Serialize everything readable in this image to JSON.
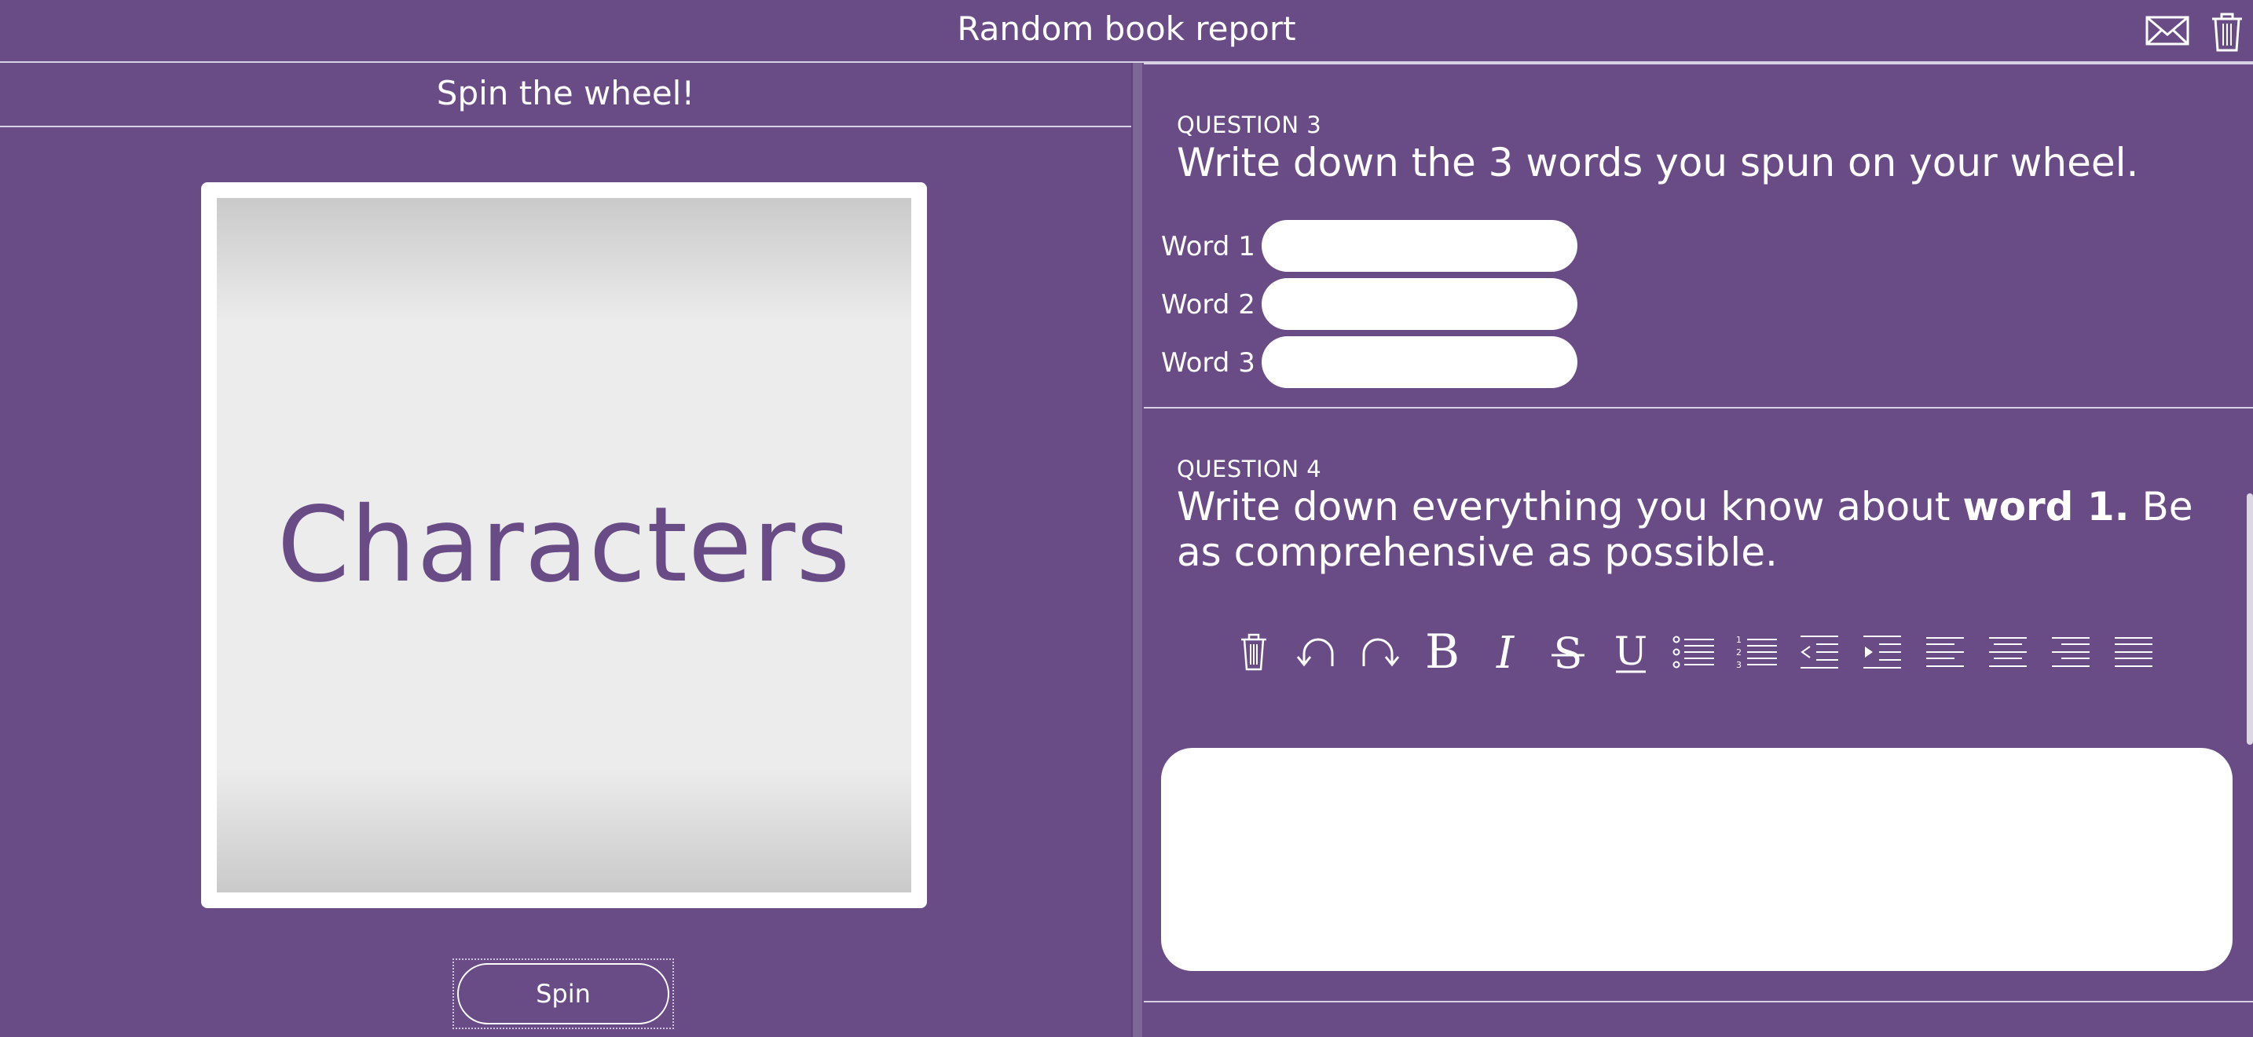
{
  "header": {
    "title": "Random book report",
    "mail_icon": "envelope-icon",
    "trash_icon": "trash-icon"
  },
  "left": {
    "title": "Spin the wheel!",
    "wheel_word": "Characters",
    "spin_label": "Spin"
  },
  "question3": {
    "label": "QUESTION 3",
    "prompt": "Write down the 3 words you spun on your wheel.",
    "fields": [
      {
        "label": "Word 1",
        "value": ""
      },
      {
        "label": "Word 2",
        "value": ""
      },
      {
        "label": "Word 3",
        "value": ""
      }
    ]
  },
  "question4": {
    "label": "QUESTION 4",
    "prompt_before": "Write down everything you know about ",
    "prompt_bold": "word 1.",
    "prompt_after": " Be as comprehensive as possible.",
    "toolbar": [
      "trash-icon",
      "undo-icon",
      "redo-icon",
      "bold-icon",
      "italic-icon",
      "strikethrough-icon",
      "underline-icon",
      "bullet-list-icon",
      "numbered-list-icon",
      "outdent-icon",
      "indent-icon",
      "align-left-icon",
      "align-center-icon",
      "align-right-icon",
      "justify-icon"
    ],
    "colors": [
      "#000000",
      "#e0321e",
      "#1f1fd6",
      "#2c7a1c"
    ],
    "editor_text": ""
  },
  "colors": {
    "background": "#694b86",
    "accent_text": "#694b86"
  }
}
